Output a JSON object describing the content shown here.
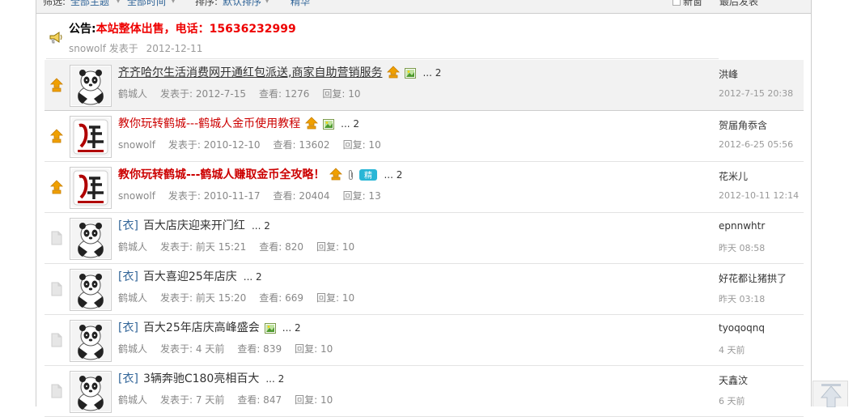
{
  "filterbar": {
    "filter_label": "筛选:",
    "filter_value": "全部主题",
    "time_value": "全部时间",
    "sort_label": "排序:",
    "sort_value": "默认排序",
    "digest_label": "精华",
    "new_window_label": "新窗",
    "last_post_label": "最后发表"
  },
  "notice": {
    "prefix": "公告:",
    "text": "本站整体出售，电话：15636232999",
    "author": "snowolf",
    "posted_label": "发表于",
    "date": "2012-12-11"
  },
  "threads": [
    {
      "category": "",
      "title": "齐齐哈尔生活消费网开通红包派送,商家自助营销服务",
      "pages": "... 2",
      "author": "鹤城人",
      "posted": "发表于: 2012-7-15",
      "views": "查看: 1276",
      "replies": "回复: 10",
      "last_user": "洪峰",
      "last_time": "2012-7-15 20:38"
    },
    {
      "category": "",
      "title": "教你玩转鹤城---鹤城人金币使用教程",
      "pages": "... 2",
      "author": "snowolf",
      "posted": "发表于: 2010-12-10",
      "views": "查看: 13602",
      "replies": "回复: 10",
      "last_user": "贺届角忝含",
      "last_time": "2012-6-25 05:56"
    },
    {
      "category": "",
      "title": "教你玩转鹤城---鹤城人赚取金币全攻略！",
      "pages": "... 2",
      "author": "snowolf",
      "posted": "发表于: 2010-11-17",
      "views": "查看: 20404",
      "replies": "回复: 13",
      "last_user": "花米儿",
      "last_time": "2012-10-11 12:14"
    },
    {
      "category": "[衣]",
      "title": "百大店庆迎来开门红",
      "pages": "... 2",
      "author": "鹤城人",
      "posted": "发表于: 前天 15:21",
      "views": "查看: 820",
      "replies": "回复: 10",
      "last_user": "epnnwhtr",
      "last_time": "昨天 08:58"
    },
    {
      "category": "[衣]",
      "title": "百大喜迎25年店庆",
      "pages": "... 2",
      "author": "鹤城人",
      "posted": "发表于: 前天 15:20",
      "views": "查看: 669",
      "replies": "回复: 10",
      "last_user": "好花都让猪拱了",
      "last_time": "昨天 03:18"
    },
    {
      "category": "[衣]",
      "title": "百大25年店庆高峰盛会",
      "pages": "... 2",
      "author": "鹤城人",
      "posted": "发表于: 4 天前",
      "views": "查看: 839",
      "replies": "回复: 10",
      "last_user": "tyoqoqnq",
      "last_time": "4 天前"
    },
    {
      "category": "[衣]",
      "title": "3辆奔驰C180亮相百大",
      "pages": "... 2",
      "author": "鹤城人",
      "posted": "发表于: 7 天前",
      "views": "查看: 847",
      "replies": "回复: 10",
      "last_user": "天鑫汶",
      "last_time": "6 天前"
    }
  ],
  "icons": {
    "notice": "megaphone-icon",
    "pinned": "pin-up-arrow-icon",
    "normal": "doc-icon",
    "image": "image-attachment-icon",
    "attachment": "paperclip-icon",
    "digest": "digest-badge-icon",
    "scroll_top": "back-to-top-icon"
  },
  "colors": {
    "pinned_orange": "#f0a000",
    "red_title": "#c00000",
    "link_blue": "#336699"
  }
}
